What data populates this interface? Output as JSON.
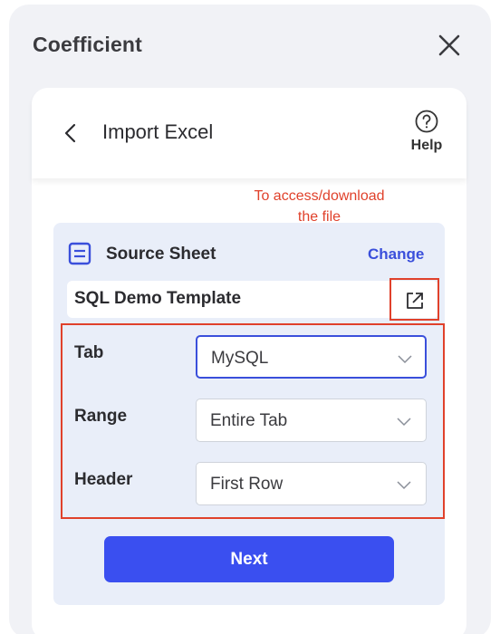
{
  "app": {
    "title": "Coefficient"
  },
  "header": {
    "title": "Import Excel",
    "help_label": "Help"
  },
  "annotation": {
    "line1": "To access/download",
    "line2": "the file"
  },
  "source": {
    "label": "Source Sheet",
    "change_label": "Change",
    "sheet_name": "SQL Demo Template"
  },
  "fields": [
    {
      "label": "Tab",
      "value": "MySQL"
    },
    {
      "label": "Range",
      "value": "Entire Tab"
    },
    {
      "label": "Header",
      "value": "First Row"
    }
  ],
  "actions": {
    "next_label": "Next"
  },
  "colors": {
    "accent": "#3a4ff0",
    "annotation": "#e0412b",
    "panel_bg": "#f1f2f6",
    "source_bg": "#e9eef9"
  }
}
